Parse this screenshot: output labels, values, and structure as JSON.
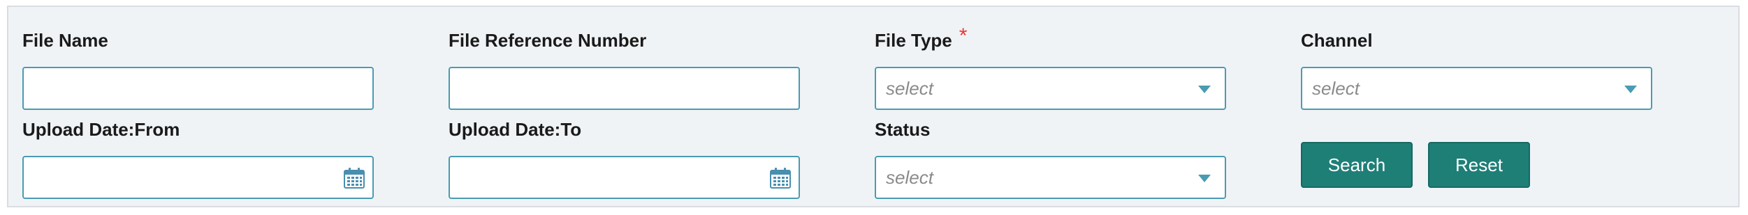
{
  "form": {
    "file_name": {
      "label": "File Name",
      "value": ""
    },
    "file_reference_number": {
      "label": "File Reference Number",
      "value": ""
    },
    "file_type": {
      "label": "File Type",
      "required_marker": "*",
      "value": "select"
    },
    "channel": {
      "label": "Channel",
      "value": "select"
    },
    "upload_date_from": {
      "label": "Upload Date:From",
      "value": ""
    },
    "upload_date_to": {
      "label": "Upload Date:To",
      "value": ""
    },
    "status": {
      "label": "Status",
      "value": "select"
    }
  },
  "buttons": {
    "search": "Search",
    "reset": "Reset"
  },
  "icons": {
    "calendar": "calendar-icon",
    "dropdown": "chevron-down-icon"
  },
  "colors": {
    "panel_bg": "#f0f3f6",
    "input_border": "#4a9bb3",
    "button_bg": "#1e7f77",
    "required": "#e53935"
  }
}
